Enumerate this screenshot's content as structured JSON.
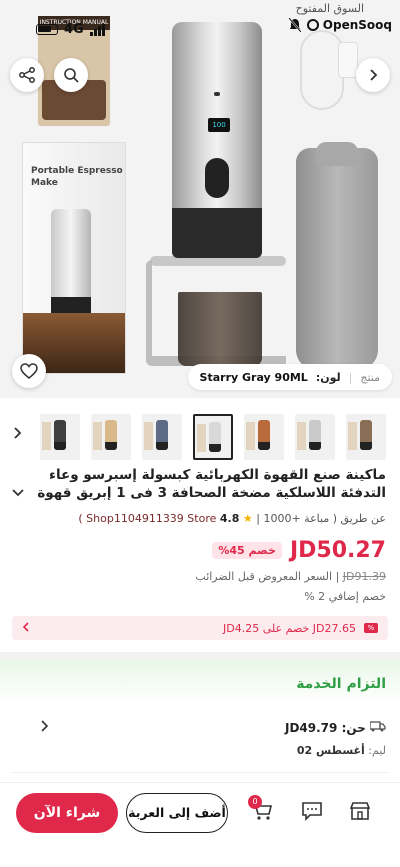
{
  "status_bar": {
    "network": "4G",
    "brand_ar": "السوق المفتوح",
    "brand": "OpenSooq"
  },
  "hero": {
    "box_caption": "INSTRUCTION MANUAL",
    "pack_title": "Portable Espresso Make",
    "display_text": "100",
    "variant_prefix": "منتج",
    "variant_label": "لون:",
    "variant_value": "Starry Gray 90ML"
  },
  "thumbnails": {
    "colors": [
      "#8a6f56",
      "#c9c9c9",
      "#b86a3a",
      "#d8d8d8",
      "#5d6b86",
      "#d9b98a",
      "#3f3f3f",
      "#b3b3b3",
      "#dba86e",
      "#c8c8c8"
    ],
    "active_index": 3
  },
  "product": {
    "title": "ماكينة صنع القهوة الكهربائية كبسولة إسبرسو وعاء التدفئة اللاسلكية مضخة الصحافة 3 فى 1 إبريق قهوة د",
    "seller_prefix": "عن طريق",
    "sold": "( مباعة +1000 |",
    "rating": "4.8",
    "store": "Shop1104911339 Store )",
    "price": "JD50.27",
    "discount": "خصم 45%",
    "old_price": "JD91.39",
    "old_price_note": "| السعر المعروض قبل الضرائب",
    "extra_discount": "خصم إضافي 2 %",
    "coupon_text": "JD27.65 خصم على JD4.25"
  },
  "service": {
    "title": "التزام الخدمة",
    "delivery_price": "JD49.79",
    "delivery_prefix": "حن:",
    "delivery_date_label": "ليم:",
    "delivery_date": "أغسطس 02"
  },
  "bottom_bar": {
    "buy_now": "شراء الآن",
    "add_to_cart": "أضف إلى العربة",
    "cart_count": "0"
  }
}
